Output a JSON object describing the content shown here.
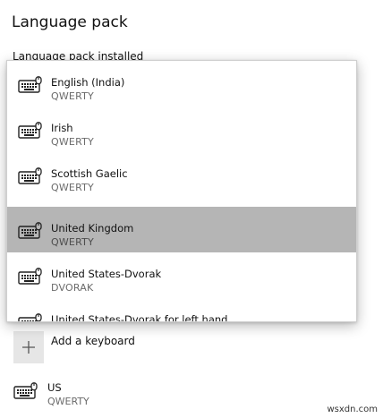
{
  "section": {
    "title": "Language pack",
    "subtitle": "Language pack installed"
  },
  "flyout": {
    "items": [
      {
        "name": "English (India)",
        "layout": "QWERTY",
        "selected": false,
        "icon": "keyboard-icon"
      },
      {
        "name": "Irish",
        "layout": "QWERTY",
        "selected": false,
        "icon": "keyboard-icon"
      },
      {
        "name": "Scottish Gaelic",
        "layout": "QWERTY",
        "selected": false,
        "icon": "keyboard-icon"
      },
      {
        "name": "United Kingdom",
        "layout": "QWERTY",
        "selected": true,
        "icon": "keyboard-icon"
      },
      {
        "name": "United States-Dvorak",
        "layout": "DVORAK",
        "selected": false,
        "icon": "keyboard-icon"
      },
      {
        "name": "United States-Dvorak for left hand",
        "layout": "",
        "selected": false,
        "icon": "keyboard-icon"
      }
    ],
    "selected_color": "#b5b5b5"
  },
  "add_keyboard": {
    "label": "Add a keyboard",
    "icon": "plus-icon"
  },
  "installed_keyboard": {
    "name": "US",
    "layout": "QWERTY",
    "icon": "keyboard-icon"
  },
  "watermark": "wsxdn.com"
}
